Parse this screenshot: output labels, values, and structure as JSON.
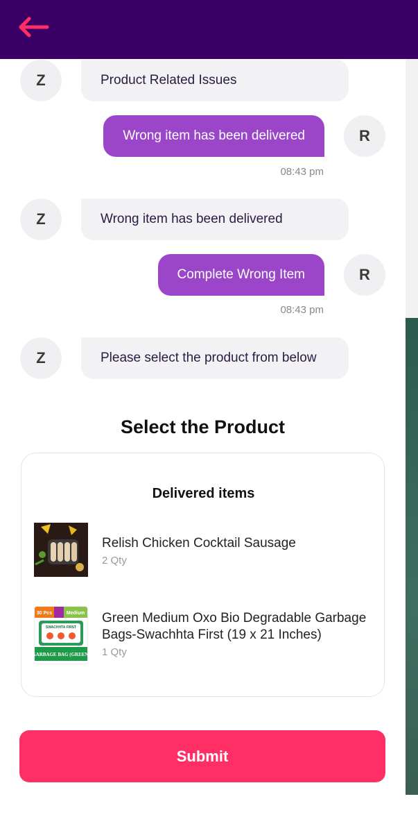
{
  "header": {
    "back_icon": "back-arrow-icon",
    "accent": "#ff2f66",
    "bg": "#3b0066"
  },
  "chat": {
    "bot_initial": "Z",
    "user_initial": "R",
    "messages": [
      {
        "from": "bot",
        "text": "Product Related Issues"
      },
      {
        "from": "user",
        "text": "Wrong item has been delivered",
        "time": "08:43 pm"
      },
      {
        "from": "bot",
        "text": "Wrong item has been delivered"
      },
      {
        "from": "user",
        "text": "Complete Wrong Item",
        "time": "08:43 pm"
      },
      {
        "from": "bot",
        "text": "Please select the product from below"
      }
    ]
  },
  "select": {
    "title": "Select the Product",
    "card_title": "Delivered items",
    "items": [
      {
        "name": "Relish Chicken Cocktail Sausage",
        "qty": "2 Qty"
      },
      {
        "name": "Green Medium Oxo Bio Degradable Garbage Bags-Swachhta First (19 x 21 Inches)",
        "qty": "1 Qty",
        "pack_labels": {
          "count": "30 Pcs",
          "size": "Medium",
          "brand": "SWACHHTA FIRST",
          "band": "GARBAGE BAG (GREEN)"
        }
      }
    ]
  },
  "submit_label": "Submit",
  "colors": {
    "bot_bubble": "#f2f2f4",
    "user_bubble": "#9b45c9",
    "submit": "#ff2f66"
  }
}
